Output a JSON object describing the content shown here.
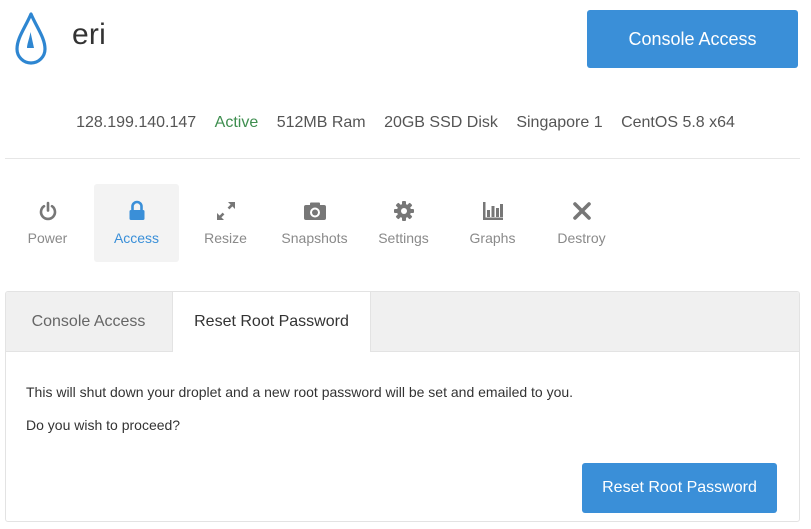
{
  "header": {
    "droplet_name": "eri",
    "console_button": "Console Access"
  },
  "info": {
    "ip": "128.199.140.147",
    "status": "Active",
    "ram": "512MB Ram",
    "disk": "20GB SSD Disk",
    "region": "Singapore 1",
    "os": "CentOS 5.8 x64"
  },
  "nav": {
    "items": [
      {
        "label": "Power",
        "icon": "power-icon"
      },
      {
        "label": "Access",
        "icon": "lock-icon",
        "active": true
      },
      {
        "label": "Resize",
        "icon": "resize-icon"
      },
      {
        "label": "Snapshots",
        "icon": "camera-icon"
      },
      {
        "label": "Settings",
        "icon": "gear-icon"
      },
      {
        "label": "Graphs",
        "icon": "bar-chart-icon"
      },
      {
        "label": "Destroy",
        "icon": "close-icon"
      }
    ]
  },
  "panel": {
    "tabs": [
      "Console Access",
      "Reset Root Password"
    ],
    "active_tab": "Reset Root Password",
    "message": "This will shut down your droplet and a new root password will be set and emailed to you.",
    "question": "Do you wish to proceed?",
    "action_button": "Reset Root Password"
  },
  "colors": {
    "accent": "#3a8fd8",
    "status_active": "#3e8e4f",
    "nav_inactive": "#8a8a8a"
  }
}
